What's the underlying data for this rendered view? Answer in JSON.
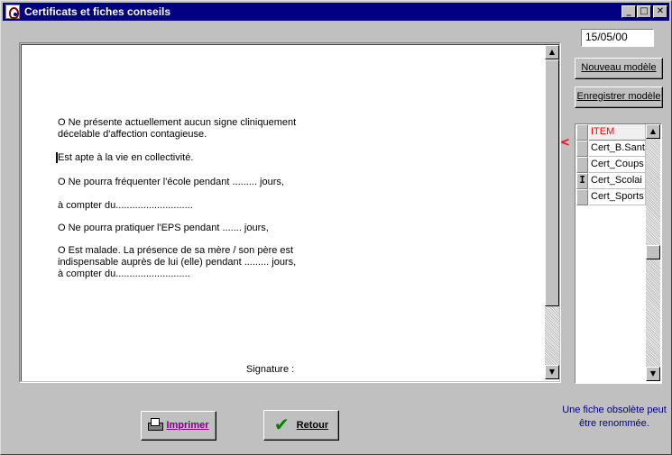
{
  "window": {
    "title": "Certificats et fiches conseils",
    "minimize_glyph": "_",
    "maximize_glyph": "□",
    "close_glyph": "✕"
  },
  "date": "15/05/00",
  "buttons": {
    "new_model": "Nouveau modèle",
    "save_model": "Enregistrer modèle",
    "print": "Imprimer",
    "back": "Retour"
  },
  "document": {
    "paragraph_1": "O Ne présente actuellement aucun signe cliniquement\ndécelable d'affection contagieuse.",
    "paragraph_2": "Est apte à la vie en collectivité.",
    "paragraph_3": "O Ne pourra fréquenter l'école pendant ......... jours,",
    "paragraph_4": "à compter du............................",
    "paragraph_5": "O Ne pourra pratiquer l'EPS  pendant ....... jours,",
    "paragraph_6": "O Est malade. La présence de sa mère / son père est\nindispensable auprès de lui (elle) pendant ......... jours,\nà compter du...........................",
    "signature": "Signature :"
  },
  "list": {
    "header": "ITEM",
    "items": [
      "Cert_B.Sant",
      "Cert_Coups",
      "Cert_Scolai",
      "Cert_Sports"
    ],
    "selected_index": 2,
    "selected_marker": "I"
  },
  "marker_glyph": "<",
  "hint": "Une fiche obsolète peut\nêtre renommée.",
  "icons": {
    "print": "printer-icon",
    "back": "checkmark-icon",
    "check_glyph": "✔",
    "scroll_up": "▲",
    "scroll_down": "▼"
  },
  "colors": {
    "titlebar": "#000080",
    "list_header_text": "#ff0000",
    "hint_text": "#000080",
    "print_label": "#800080",
    "check": "#008000"
  }
}
